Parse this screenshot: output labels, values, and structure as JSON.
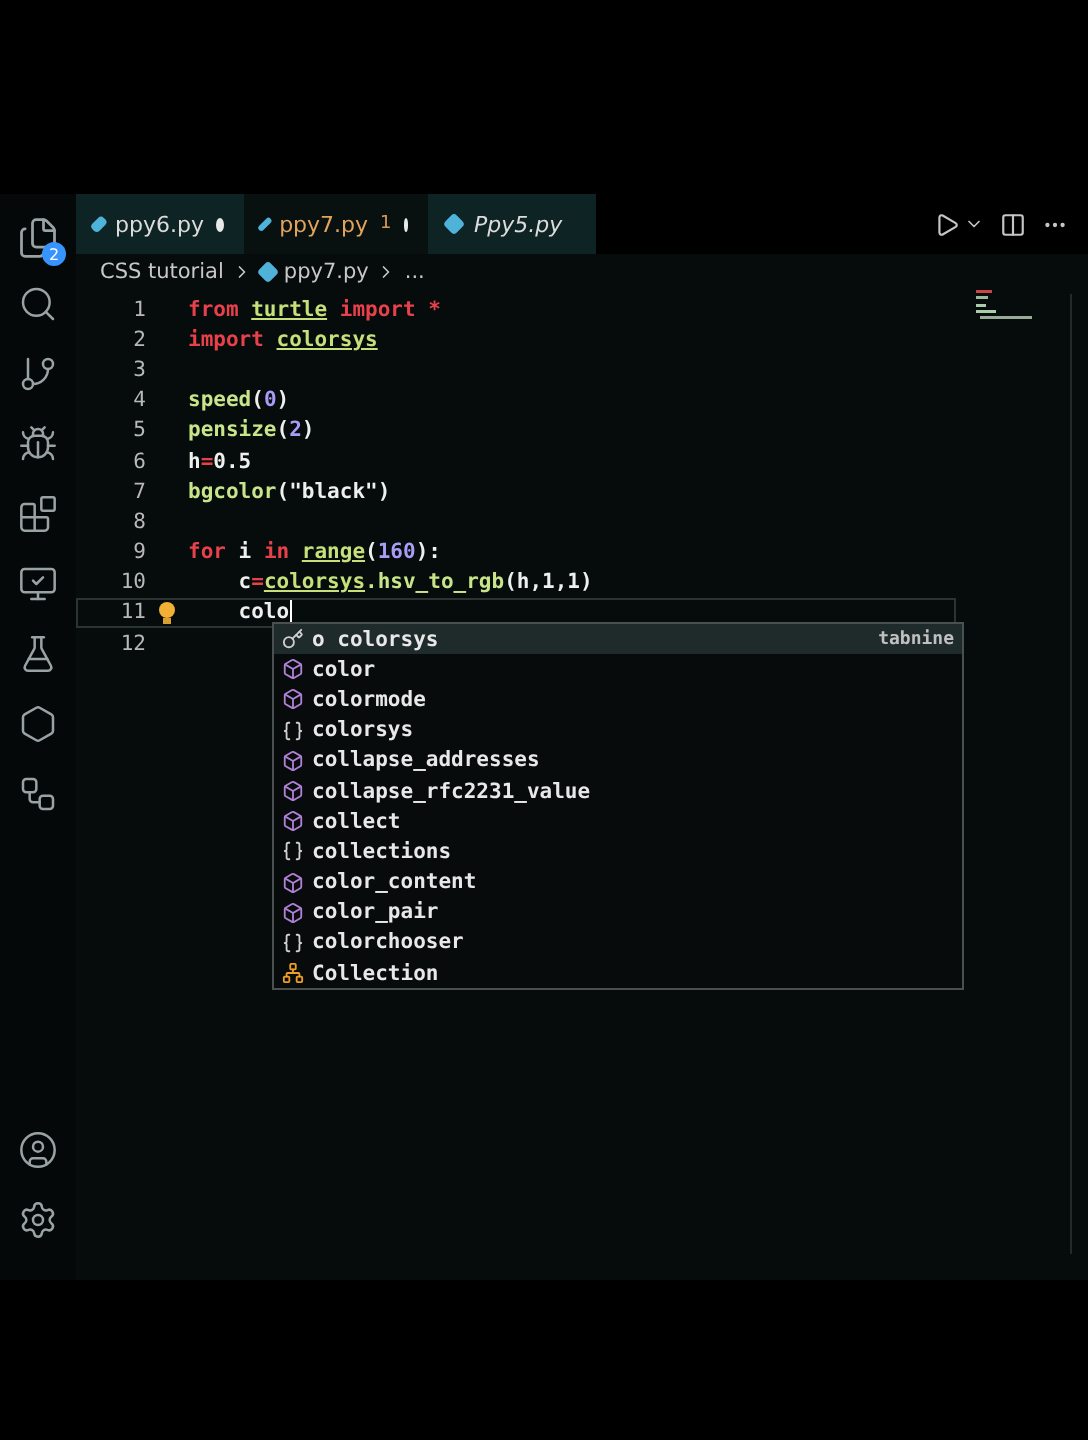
{
  "activity_bar": {
    "explorer_badge": "2"
  },
  "tabs": [
    {
      "label": "ppy6.py",
      "selected": false,
      "modified": true,
      "preview": false
    },
    {
      "label": "ppy7.py",
      "selected": true,
      "modified": true,
      "preview": false,
      "problems": "1"
    },
    {
      "label": "Ppy5.py",
      "selected": false,
      "modified": false,
      "preview": true
    }
  ],
  "breadcrumb": [
    "CSS tutorial",
    "ppy7.py",
    "..."
  ],
  "code_lines": [
    {
      "number": "1",
      "current": false,
      "tokens": [
        {
          "kind": "keyword",
          "text": "from "
        },
        {
          "kind": "module",
          "text": "turtle"
        },
        {
          "kind": "keyword",
          "text": " import *"
        }
      ]
    },
    {
      "number": "2",
      "current": false,
      "tokens": [
        {
          "kind": "keyword",
          "text": "import "
        },
        {
          "kind": "module",
          "text": "colorsys"
        }
      ]
    },
    {
      "number": "3",
      "current": false
    },
    {
      "number": "4",
      "current": false,
      "tokens": [
        {
          "kind": "func",
          "text": "speed"
        },
        {
          "kind": "plain",
          "text": "("
        },
        {
          "kind": "number",
          "text": "0"
        },
        {
          "kind": "plain",
          "text": ")"
        }
      ]
    },
    {
      "number": "5",
      "current": false,
      "tokens": [
        {
          "kind": "func",
          "text": "pensize"
        },
        {
          "kind": "plain",
          "text": "("
        },
        {
          "kind": "number",
          "text": "2"
        },
        {
          "kind": "plain",
          "text": ")"
        }
      ]
    },
    {
      "number": "6",
      "current": false,
      "tokens": [
        {
          "kind": "plain",
          "text": "h"
        },
        {
          "kind": "keyword",
          "text": "="
        },
        {
          "kind": "plain",
          "text": "0.5"
        }
      ]
    },
    {
      "number": "7",
      "current": false,
      "tokens": [
        {
          "kind": "func",
          "text": "bgcolor"
        },
        {
          "kind": "plain",
          "text": "(\"black\")"
        }
      ]
    },
    {
      "number": "8",
      "current": false
    },
    {
      "number": "9",
      "current": false,
      "tokens": [
        {
          "kind": "keyword",
          "text": "for"
        },
        {
          "kind": "plain",
          "text": " i "
        },
        {
          "kind": "keyword",
          "text": "in "
        },
        {
          "kind": "module",
          "text": "range"
        },
        {
          "kind": "plain",
          "text": "("
        },
        {
          "kind": "number",
          "text": "160"
        },
        {
          "kind": "plain",
          "text": "):"
        }
      ]
    },
    {
      "number": "10",
      "current": false,
      "tokens": [
        {
          "kind": "plain",
          "text": "    c"
        },
        {
          "kind": "keyword",
          "text": "="
        },
        {
          "kind": "module",
          "text": "colorsys"
        },
        {
          "kind": "func",
          "text": ".hsv_to_rgb"
        },
        {
          "kind": "plain",
          "text": "(h,1,1)"
        }
      ]
    },
    {
      "number": "11",
      "current": true,
      "tokens": [
        {
          "kind": "plain",
          "text": "    colo"
        }
      ]
    },
    {
      "number": "12",
      "current": false
    }
  ],
  "suggestions": [
    {
      "kind": "key",
      "label": "o colorsys",
      "detail": "tabnine",
      "selected": true
    },
    {
      "kind": "function",
      "label": "color",
      "selected": false
    },
    {
      "kind": "function",
      "label": "colormode",
      "selected": false
    },
    {
      "kind": "module",
      "label": "colorsys",
      "selected": false
    },
    {
      "kind": "function",
      "label": "collapse_addresses",
      "selected": false
    },
    {
      "kind": "function",
      "label": "collapse_rfc2231_value",
      "selected": false
    },
    {
      "kind": "function",
      "label": "collect",
      "selected": false
    },
    {
      "kind": "module",
      "label": "collections",
      "selected": false
    },
    {
      "kind": "function",
      "label": "color_content",
      "selected": false
    },
    {
      "kind": "function",
      "label": "color_pair",
      "selected": false
    },
    {
      "kind": "module",
      "label": "colorchooser",
      "selected": false
    },
    {
      "kind": "class",
      "label": "Collection",
      "selected": false
    }
  ]
}
